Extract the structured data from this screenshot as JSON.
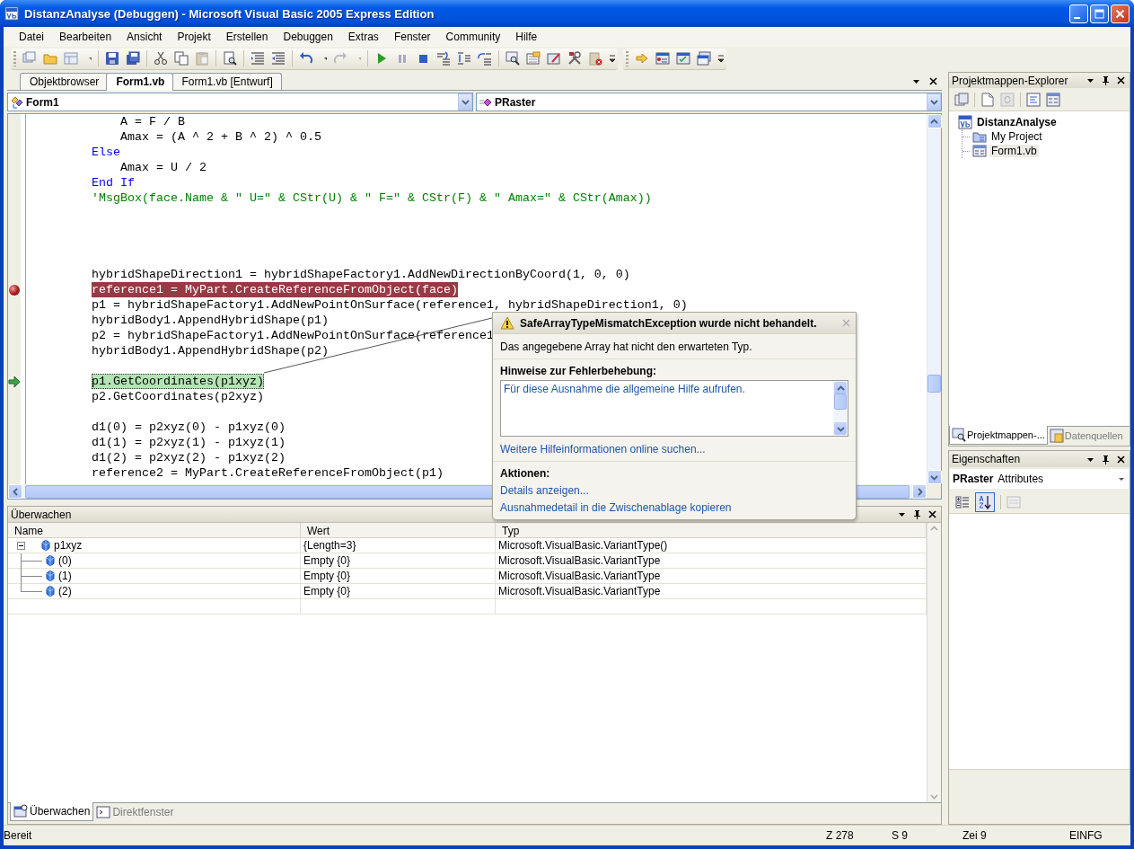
{
  "window": {
    "title": "DistanzAnalyse (Debuggen) - Microsoft Visual Basic 2005 Express Edition"
  },
  "menu": [
    "Datei",
    "Bearbeiten",
    "Ansicht",
    "Projekt",
    "Erstellen",
    "Debuggen",
    "Extras",
    "Fenster",
    "Community",
    "Hilfe"
  ],
  "document_tabs": [
    {
      "label": "Objektbrowser",
      "selected": false
    },
    {
      "label": "Form1.vb",
      "selected": true
    },
    {
      "label": "Form1.vb [Entwurf]",
      "selected": false
    }
  ],
  "class_dropdown": {
    "value": "Form1"
  },
  "member_dropdown": {
    "value": "PRaster"
  },
  "code_lines": [
    {
      "kind": "code",
      "text": "    A = F / B",
      "breakpoint": false,
      "current": false
    },
    {
      "kind": "code",
      "text": "    Amax = (A ^ 2 + B ^ 2) ^ 0.5",
      "breakpoint": false,
      "current": false
    },
    {
      "kind": "keyword",
      "text": "Else",
      "breakpoint": false,
      "current": false
    },
    {
      "kind": "code",
      "text": "    Amax = U / 2",
      "breakpoint": false,
      "current": false
    },
    {
      "kind": "keyword",
      "text": "End If",
      "breakpoint": false,
      "current": false
    },
    {
      "kind": "comment",
      "text": "'MsgBox(face.Name & \" U=\" & CStr(U) & \" F=\" & CStr(F) & \" Amax=\" & CStr(Amax))",
      "breakpoint": false,
      "current": false
    },
    {
      "kind": "blank",
      "breakpoint": false,
      "current": false
    },
    {
      "kind": "blank",
      "breakpoint": false,
      "current": false
    },
    {
      "kind": "blank",
      "breakpoint": false,
      "current": false
    },
    {
      "kind": "blank",
      "breakpoint": false,
      "current": false
    },
    {
      "kind": "code",
      "text": "hybridShapeDirection1 = hybridShapeFactory1.AddNewDirectionByCoord(1, 0, 0)",
      "breakpoint": false,
      "current": false
    },
    {
      "kind": "code",
      "text": "reference1 = MyPart.CreateReferenceFromObject(face)",
      "breakpoint": true,
      "current": false
    },
    {
      "kind": "code",
      "text": "p1 = hybridShapeFactory1.AddNewPointOnSurface(reference1, hybridShapeDirection1, 0)",
      "breakpoint": false,
      "current": false
    },
    {
      "kind": "code",
      "text": "hybridBody1.AppendHybridShape(p1)",
      "breakpoint": false,
      "current": false
    },
    {
      "kind": "code",
      "text": "p2 = hybridShapeFactory1.AddNewPointOnSurface(reference1",
      "breakpoint": false,
      "current": false
    },
    {
      "kind": "code",
      "text": "hybridBody1.AppendHybridShape(p2)",
      "breakpoint": false,
      "current": false
    },
    {
      "kind": "blank",
      "breakpoint": false,
      "current": false
    },
    {
      "kind": "code",
      "text": "p1.GetCoordinates(p1xyz)",
      "breakpoint": false,
      "current": true
    },
    {
      "kind": "code",
      "text": "p2.GetCoordinates(p2xyz)",
      "breakpoint": false,
      "current": false
    },
    {
      "kind": "blank",
      "breakpoint": false,
      "current": false
    },
    {
      "kind": "code",
      "text": "d1(0) = p2xyz(0) - p1xyz(0)",
      "breakpoint": false,
      "current": false
    },
    {
      "kind": "code",
      "text": "d1(1) = p2xyz(1) - p1xyz(1)",
      "breakpoint": false,
      "current": false
    },
    {
      "kind": "code",
      "text": "d1(2) = p2xyz(2) - p1xyz(2)",
      "breakpoint": false,
      "current": false
    },
    {
      "kind": "code",
      "text": "reference2 = MyPart.CreateReferenceFromObject(p1)",
      "breakpoint": false,
      "current": false
    }
  ],
  "exception_popup": {
    "title": "SafeArrayTypeMismatchException wurde nicht behandelt.",
    "message": "Das angegebene Array hat nicht den erwarteten Typ.",
    "hints_heading": "Hinweise zur Fehlerbehebung:",
    "hints": [
      "Für diese Ausnahme die allgemeine Hilfe aufrufen."
    ],
    "more_link": "Weitere Hilfeinformationen online suchen...",
    "actions_heading": "Aktionen:",
    "actions": [
      "Details anzeigen...",
      "Ausnahmedetail in die Zwischenablage kopieren"
    ]
  },
  "watch": {
    "title": "Überwachen",
    "columns": [
      "Name",
      "Wert",
      "Typ"
    ],
    "rows": [
      {
        "name": "p1xyz",
        "value": "{Length=3}",
        "type": "Microsoft.VisualBasic.VariantType()",
        "expanded": true,
        "children": [
          {
            "name": "(0)",
            "value": "Empty {0}",
            "type": "Microsoft.VisualBasic.VariantType"
          },
          {
            "name": "(1)",
            "value": "Empty {0}",
            "type": "Microsoft.VisualBasic.VariantType"
          },
          {
            "name": "(2)",
            "value": "Empty {0}",
            "type": "Microsoft.VisualBasic.VariantType"
          }
        ]
      }
    ]
  },
  "bottom_tabs": [
    {
      "label": "Überwachen",
      "selected": true
    },
    {
      "label": "Direktfenster",
      "selected": false
    }
  ],
  "solution_explorer": {
    "title": "Projektmappen-Explorer",
    "tree": [
      {
        "label": "DistanzAnalyse",
        "kind": "solution",
        "selected": false,
        "children": [
          {
            "label": "My Project",
            "kind": "myproject",
            "selected": false
          },
          {
            "label": "Form1.vb",
            "kind": "form",
            "selected": true
          }
        ]
      }
    ]
  },
  "side_tabs": [
    {
      "label": "Projektmappen-...",
      "selected": true
    },
    {
      "label": "Datenquellen",
      "selected": false
    }
  ],
  "properties": {
    "title": "Eigenschaften",
    "object_name": "PRaster",
    "object_type": "Attributes",
    "alphabetical": true
  },
  "status_bar": {
    "state": "Bereit",
    "line": "Z 278",
    "column": "S 9",
    "char": "Zei 9",
    "mode": "EINFG"
  }
}
